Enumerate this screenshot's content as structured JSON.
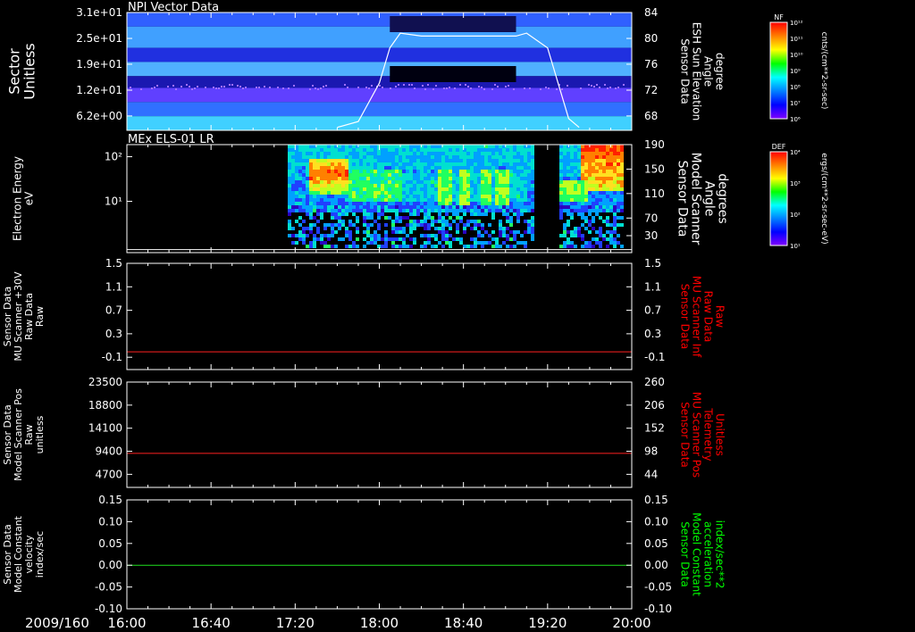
{
  "panels": [
    {
      "id": "npi",
      "title": "NPI Vector Data",
      "left_label": [
        "Sector",
        "Unitless"
      ],
      "left_ticks": [
        "3.1e+01",
        "2.5e+01",
        "1.9e+01",
        "1.2e+01",
        "6.2e+00"
      ],
      "right_label": [
        "Sensor Data",
        "ESH Sun Elevation",
        "Angle",
        "degree"
      ],
      "right_label_color": "#ffffff",
      "right_ticks": [
        "84",
        "80",
        "76",
        "72",
        "68"
      ],
      "colorbar": {
        "label": "NF",
        "ticks": [
          "10¹²",
          "10¹¹",
          "10¹⁰",
          "10⁹",
          "10⁸",
          "10⁷",
          "10⁶"
        ],
        "units": "cnts/(cm**2-sr-sec)"
      }
    },
    {
      "id": "els",
      "title": "MEx ELS-01 LR",
      "left_label": [
        "Electron Energy",
        "eV"
      ],
      "left_ticks": [
        "10²",
        "10¹"
      ],
      "right_label": [
        "Sensor Data",
        "Model Scanner",
        "Angle",
        "degrees"
      ],
      "right_label_color": "#ffffff",
      "right_ticks": [
        "190",
        "150",
        "110",
        "70",
        "30"
      ],
      "colorbar": {
        "label": "DEF",
        "ticks": [
          "10⁴",
          "10³",
          "10²",
          "10¹"
        ],
        "units": "ergs/(cm**2-sr-sec-eV)"
      }
    },
    {
      "id": "mu30",
      "title": "",
      "left_label": [
        "Sensor Data",
        "MU Scanner +30V",
        "Raw Data",
        "Raw"
      ],
      "left_ticks": [
        "1.5",
        "1.1",
        "0.7",
        "0.3",
        "-0.1"
      ],
      "right_label": [
        "Sensor Data",
        "MU Scanner Inf",
        "Raw Data",
        "Raw"
      ],
      "right_label_color": "#ff0000",
      "right_ticks": [
        "1.5",
        "1.1",
        "0.7",
        "0.3",
        "-0.1"
      ],
      "line_color": "#ff2020"
    },
    {
      "id": "pos",
      "title": "",
      "left_label": [
        "Sensor Data",
        "Model Scanner Pos",
        "Raw",
        "unitless"
      ],
      "left_ticks": [
        "23500",
        "18800",
        "14100",
        "9400",
        "4700"
      ],
      "right_label": [
        "Sensor Data",
        "MU Scanner Pos",
        "Telemetry",
        "Unitless"
      ],
      "right_label_color": "#ff0000",
      "right_ticks": [
        "260",
        "206",
        "152",
        "98",
        "44"
      ],
      "line_color": "#ff2020"
    },
    {
      "id": "vel",
      "title": "",
      "left_label": [
        "Sensor Data",
        "Model Constant",
        "velocity",
        "index/sec"
      ],
      "left_ticks": [
        "0.15",
        "0.10",
        "0.05",
        "0.00",
        "-0.05",
        "-0.10"
      ],
      "right_label": [
        "Sensor Data",
        "Model Constant",
        "acceleration",
        "index/sec**2"
      ],
      "right_label_color": "#00ff00",
      "right_ticks": [
        "0.15",
        "0.10",
        "0.05",
        "0.00",
        "-0.05",
        "-0.10"
      ],
      "line_color": "#20e020"
    }
  ],
  "x_axis": {
    "date": "2009/160",
    "ticks": [
      "16:00",
      "16:40",
      "17:20",
      "18:00",
      "18:40",
      "19:20",
      "20:00"
    ]
  },
  "chart_data": [
    {
      "type": "heatmap",
      "title": "NPI Vector Data",
      "ylabel": "Sector Unitless",
      "x": [
        "16:00",
        "16:40",
        "17:20",
        "18:00",
        "18:40",
        "19:20",
        "20:00"
      ],
      "y_ticks": [
        31,
        25,
        19,
        12,
        6.2
      ],
      "colorbar_label": "NF",
      "overlay_line": {
        "name": "ESH Sun Elevation Angle",
        "x": [
          "17:40",
          "17:50",
          "18:00",
          "18:05",
          "18:10",
          "18:20",
          "18:40",
          "19:00",
          "19:05",
          "19:10",
          "19:20",
          "19:25",
          "19:30",
          "19:35"
        ],
        "y": [
          64.5,
          65.5,
          72,
          78,
          80.5,
          80,
          80,
          80,
          80,
          80.5,
          78,
          72,
          66,
          64.5
        ],
        "ylim": [
          64,
          84
        ]
      }
    },
    {
      "type": "heatmap",
      "title": "MEx ELS-01 LR",
      "ylabel": "Electron Energy eV",
      "y_scale": "log",
      "x": [
        "16:00",
        "16:40",
        "17:20",
        "18:00",
        "18:40",
        "19:20",
        "20:00"
      ],
      "colorbar_label": "DEF",
      "overlay_line": {
        "name": "Model Scanner Angle",
        "y": [
          15
        ],
        "ylim": [
          10,
          190
        ]
      }
    },
    {
      "type": "line",
      "ylabel": "MU Scanner +30V Raw",
      "x": [
        "16:00",
        "20:00"
      ],
      "series": [
        {
          "values": [
            0.0,
            0.0
          ]
        }
      ],
      "ylim": [
        -0.3,
        1.5
      ]
    },
    {
      "type": "line",
      "ylabel": "Model Scanner Pos Raw",
      "x": [
        "16:00",
        "20:00"
      ],
      "series": [
        {
          "values": [
            7600,
            7600
          ]
        }
      ],
      "ylim": [
        0,
        23500
      ]
    },
    {
      "type": "line",
      "ylabel": "Model Constant velocity index/sec",
      "x": [
        "16:00",
        "20:00"
      ],
      "series": [
        {
          "values": [
            0.0,
            0.0
          ]
        }
      ],
      "ylim": [
        -0.1,
        0.15
      ]
    }
  ]
}
